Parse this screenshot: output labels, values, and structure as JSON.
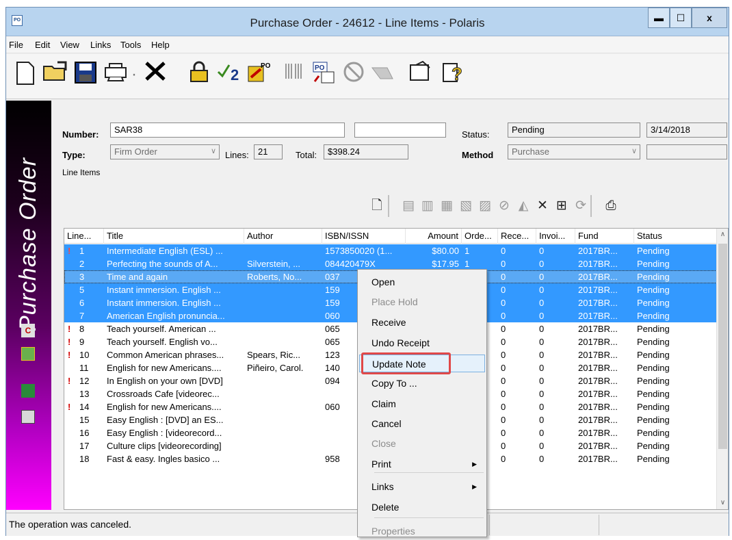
{
  "window": {
    "title": "Purchase Order - 24612 - Line Items - Polaris",
    "app_icon_label": "PO",
    "controls": {
      "minimize": "▬",
      "maximize": "☐",
      "close": "x"
    }
  },
  "menu": [
    "File",
    "Edit",
    "View",
    "Links",
    "Tools",
    "Help"
  ],
  "toolbar_icons": [
    "new-icon",
    "open-folder-icon",
    "save-icon",
    "print-icon",
    "delete-icon",
    "lock-icon",
    "approve-icon",
    "po-icon",
    "barcode-icon",
    "po-invoice-icon",
    "cancel-circle-icon",
    "hand-icon",
    "properties-icon",
    "help-icon"
  ],
  "sidebar": {
    "title": "Purchase Order",
    "accent": "#ff00ff"
  },
  "form": {
    "number_label": "Number:",
    "number_value": "SAR38",
    "extra_value": "",
    "status_label": "Status:",
    "status_value": "Pending",
    "date_value": "3/14/2018",
    "type_label": "Type:",
    "type_value": "Firm Order",
    "lines_label": "Lines:",
    "lines_value": "21",
    "total_label": "Total:",
    "total_value": "$398.24",
    "method_label": "Method",
    "method_value": "Purchase",
    "method_extra": ""
  },
  "line_items": {
    "group_label": "Line Items",
    "columns": [
      "Line...",
      "Title",
      "Author",
      "ISBN/ISSN",
      "Amount",
      "Orde...",
      "Rece...",
      "Invoi...",
      "Fund",
      "Status"
    ],
    "rows": [
      {
        "flag": "!",
        "line": "1",
        "title": "Intermediate English (ESL) ...",
        "author": "",
        "isbn": "1573850020 (1...",
        "amount": "$80.00",
        "ord": "1",
        "rec": "0",
        "inv": "0",
        "fund": "2017BR...",
        "status": "Pending",
        "selected": true
      },
      {
        "flag": "",
        "line": "2",
        "title": "Perfecting the sounds of A...",
        "author": "Silverstein, ...",
        "isbn": "084420479X",
        "amount": "$17.95",
        "ord": "1",
        "rec": "0",
        "inv": "0",
        "fund": "2017BR...",
        "status": "Pending",
        "selected": true
      },
      {
        "flag": "",
        "line": "3",
        "title": "Time and again",
        "author": "Roberts, No...",
        "isbn": "037",
        "amount": "",
        "ord": "",
        "rec": "0",
        "inv": "0",
        "fund": "2017BR...",
        "status": "Pending",
        "selected": true,
        "focus": true
      },
      {
        "flag": "",
        "line": "5",
        "title": "Instant immersion. English ...",
        "author": "",
        "isbn": "159",
        "amount": "",
        "ord": "",
        "rec": "0",
        "inv": "0",
        "fund": "2017BR...",
        "status": "Pending",
        "selected": true
      },
      {
        "flag": "",
        "line": "6",
        "title": "Instant immersion. English ...",
        "author": "",
        "isbn": "159",
        "amount": "",
        "ord": "",
        "rec": "0",
        "inv": "0",
        "fund": "2017BR...",
        "status": "Pending",
        "selected": true
      },
      {
        "flag": "",
        "line": "7",
        "title": "American English pronuncia...",
        "author": "",
        "isbn": "060",
        "amount": "",
        "ord": "",
        "rec": "0",
        "inv": "0",
        "fund": "2017BR...",
        "status": "Pending",
        "selected": true
      },
      {
        "flag": "!",
        "line": "8",
        "title": "Teach yourself. American ...",
        "author": "",
        "isbn": "065",
        "amount": "",
        "ord": "",
        "rec": "0",
        "inv": "0",
        "fund": "2017BR...",
        "status": "Pending",
        "selected": false
      },
      {
        "flag": "!",
        "line": "9",
        "title": "Teach yourself. English vo...",
        "author": "",
        "isbn": "065",
        "amount": "",
        "ord": "",
        "rec": "0",
        "inv": "0",
        "fund": "2017BR...",
        "status": "Pending",
        "selected": false
      },
      {
        "flag": "!",
        "line": "10",
        "title": "Common American phrases...",
        "author": "Spears, Ric...",
        "isbn": "123",
        "amount": "",
        "ord": "",
        "rec": "0",
        "inv": "0",
        "fund": "2017BR...",
        "status": "Pending",
        "selected": false
      },
      {
        "flag": "",
        "line": "11",
        "title": "English for new Americans....",
        "author": "Piñeiro, Carol.",
        "isbn": "140",
        "amount": "",
        "ord": "",
        "rec": "0",
        "inv": "0",
        "fund": "2017BR...",
        "status": "Pending",
        "selected": false
      },
      {
        "flag": "!",
        "line": "12",
        "title": "In English on your own [DVD]",
        "author": "",
        "isbn": "094",
        "amount": "",
        "ord": "",
        "rec": "0",
        "inv": "0",
        "fund": "2017BR...",
        "status": "Pending",
        "selected": false
      },
      {
        "flag": "",
        "line": "13",
        "title": "Crossroads Cafe [videorec...",
        "author": "",
        "isbn": "",
        "amount": "",
        "ord": "",
        "rec": "0",
        "inv": "0",
        "fund": "2017BR...",
        "status": "Pending",
        "selected": false
      },
      {
        "flag": "!",
        "line": "14",
        "title": "English for new Americans....",
        "author": "",
        "isbn": "060",
        "amount": "",
        "ord": "",
        "rec": "0",
        "inv": "0",
        "fund": "2017BR...",
        "status": "Pending",
        "selected": false
      },
      {
        "flag": "",
        "line": "15",
        "title": "Easy English : [DVD] an ES...",
        "author": "",
        "isbn": "",
        "amount": "",
        "ord": "",
        "rec": "0",
        "inv": "0",
        "fund": "2017BR...",
        "status": "Pending",
        "selected": false
      },
      {
        "flag": "",
        "line": "16",
        "title": "Easy English : [videorecord...",
        "author": "",
        "isbn": "",
        "amount": "",
        "ord": "",
        "rec": "0",
        "inv": "0",
        "fund": "2017BR...",
        "status": "Pending",
        "selected": false
      },
      {
        "flag": "",
        "line": "17",
        "title": "Culture clips [videorecording]",
        "author": "",
        "isbn": "",
        "amount": "",
        "ord": "",
        "rec": "0",
        "inv": "0",
        "fund": "2017BR...",
        "status": "Pending",
        "selected": false
      },
      {
        "flag": "",
        "line": "18",
        "title": "Fast & easy. Ingles basico ...",
        "author": "",
        "isbn": "958",
        "amount": "",
        "ord": "",
        "rec": "0",
        "inv": "0",
        "fund": "2017BR...",
        "status": "Pending",
        "selected": false
      }
    ]
  },
  "context_menu": {
    "items": [
      {
        "label": "Open",
        "disabled": false
      },
      {
        "label": "Place Hold",
        "disabled": true
      },
      {
        "label": "Receive",
        "disabled": false
      },
      {
        "label": "Undo Receipt",
        "disabled": false
      },
      {
        "label": "Update Note",
        "disabled": false,
        "highlighted": true
      },
      {
        "label": "Copy To ...",
        "disabled": false
      },
      {
        "label": "Claim",
        "disabled": false
      },
      {
        "label": "Cancel",
        "disabled": false
      },
      {
        "label": "Close",
        "disabled": true
      },
      {
        "label": "Print",
        "disabled": false,
        "submenu": true
      },
      {
        "label": "Links",
        "disabled": false,
        "submenu": true
      },
      {
        "label": "Delete",
        "disabled": false
      },
      {
        "label": "Properties",
        "disabled": true
      }
    ]
  },
  "status_bar": {
    "message": "The operation was canceled."
  }
}
